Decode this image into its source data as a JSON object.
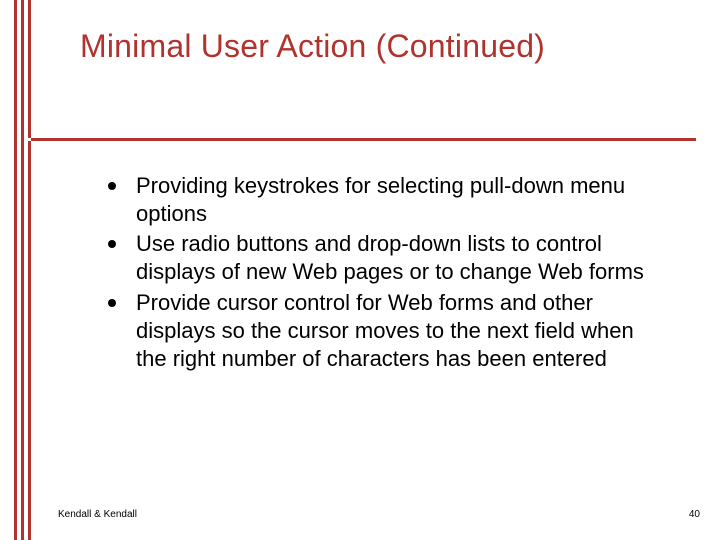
{
  "title": "Minimal User Action (Continued)",
  "bullets": [
    "Providing keystrokes for selecting pull-down menu options",
    "Use radio buttons and drop-down lists to control displays of new Web pages or to change Web forms",
    "Provide cursor control for Web forms and other displays so the cursor moves to the next field when the right number of characters has been entered"
  ],
  "footer": {
    "left": "Kendall & Kendall",
    "right": "40"
  },
  "colors": {
    "accent": "#b0332e"
  }
}
